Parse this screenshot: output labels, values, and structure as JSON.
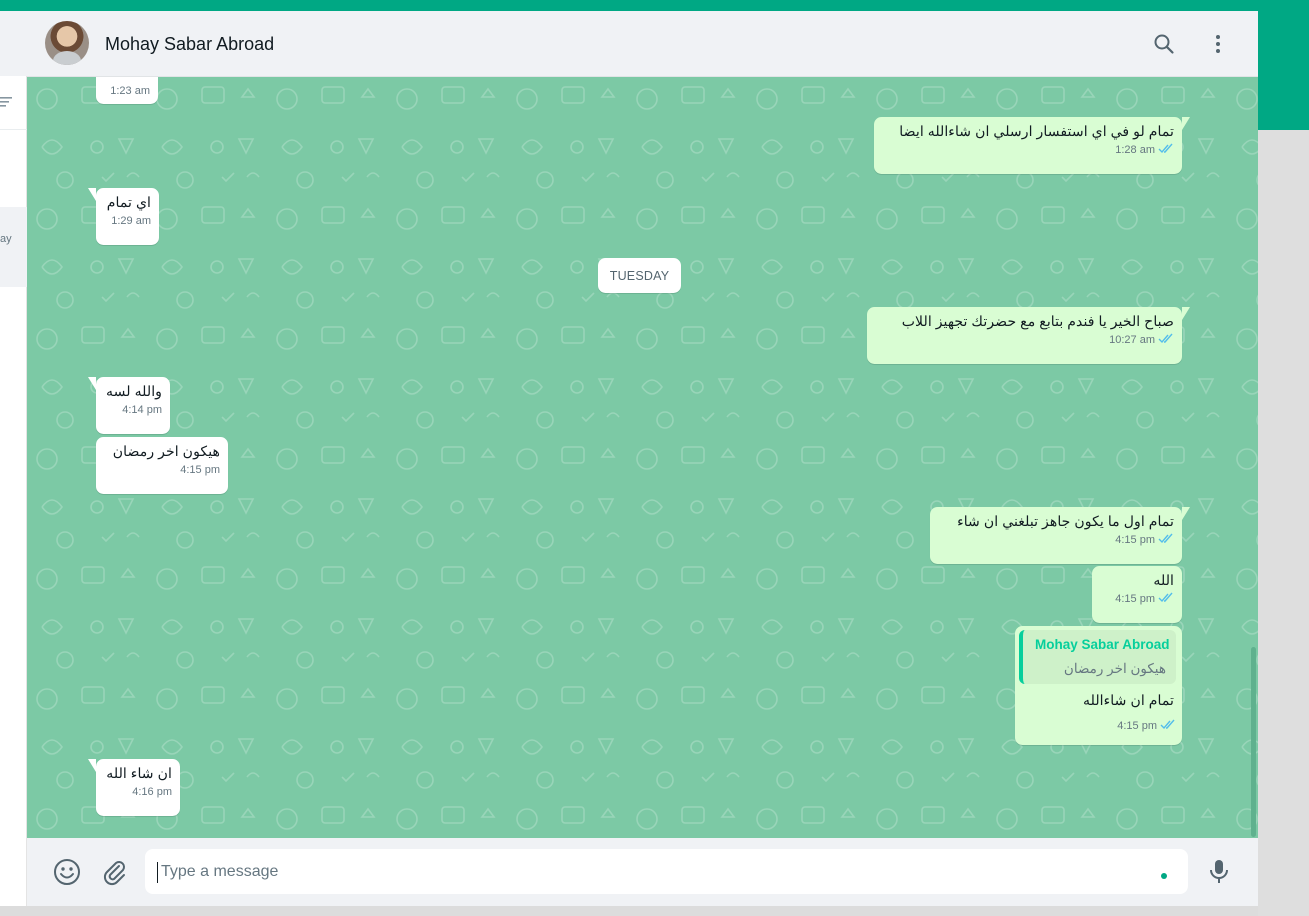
{
  "header": {
    "contact_name": "Mohay Sabar Abroad",
    "icons": [
      "search-icon",
      "menu-icon"
    ]
  },
  "sidebar": {
    "selected_preview_fragment": "ay"
  },
  "date_divider": "TUESDAY",
  "messages": [
    {
      "dir": "in",
      "text": "",
      "time": "1:23 am"
    },
    {
      "dir": "out",
      "text": "تمام لو في اي استفسار ارسلي ان شاءالله ايضا",
      "time": "1:28 am",
      "status": "read"
    },
    {
      "dir": "in",
      "text": "اي تمام",
      "time": "1:29 am"
    },
    {
      "dir": "out",
      "text": "صباح الخير يا فندم بتابع مع حضرتك تجهيز اللاب",
      "time": "10:27 am",
      "status": "read"
    },
    {
      "dir": "in",
      "text": "والله لسه",
      "time": "4:14 pm"
    },
    {
      "dir": "in",
      "text": "هيكون اخر رمضان",
      "time": "4:15 pm"
    },
    {
      "dir": "out",
      "text": "تمام اول ما يكون جاهز تبلغني ان شاء",
      "time": "4:15 pm",
      "status": "read"
    },
    {
      "dir": "out",
      "text": "الله",
      "time": "4:15 pm",
      "status": "read"
    },
    {
      "dir": "out",
      "quote_name": "Mohay Sabar Abroad",
      "quote_text": "هيكون اخر رمضان",
      "text": "تمام ان شاءالله",
      "time": "4:15 pm",
      "status": "read"
    },
    {
      "dir": "in",
      "text": "ان شاء الله",
      "time": "4:16 pm"
    }
  ],
  "composer": {
    "placeholder": "Type a message",
    "icons": [
      "emoji-icon",
      "attach-icon",
      "mic-icon"
    ]
  },
  "colors": {
    "accent": "#00a884",
    "wallpaper": "#7cc9a5",
    "incoming": "#ffffff",
    "outgoing": "#d9fdd3",
    "read_tick": "#53bdeb"
  }
}
